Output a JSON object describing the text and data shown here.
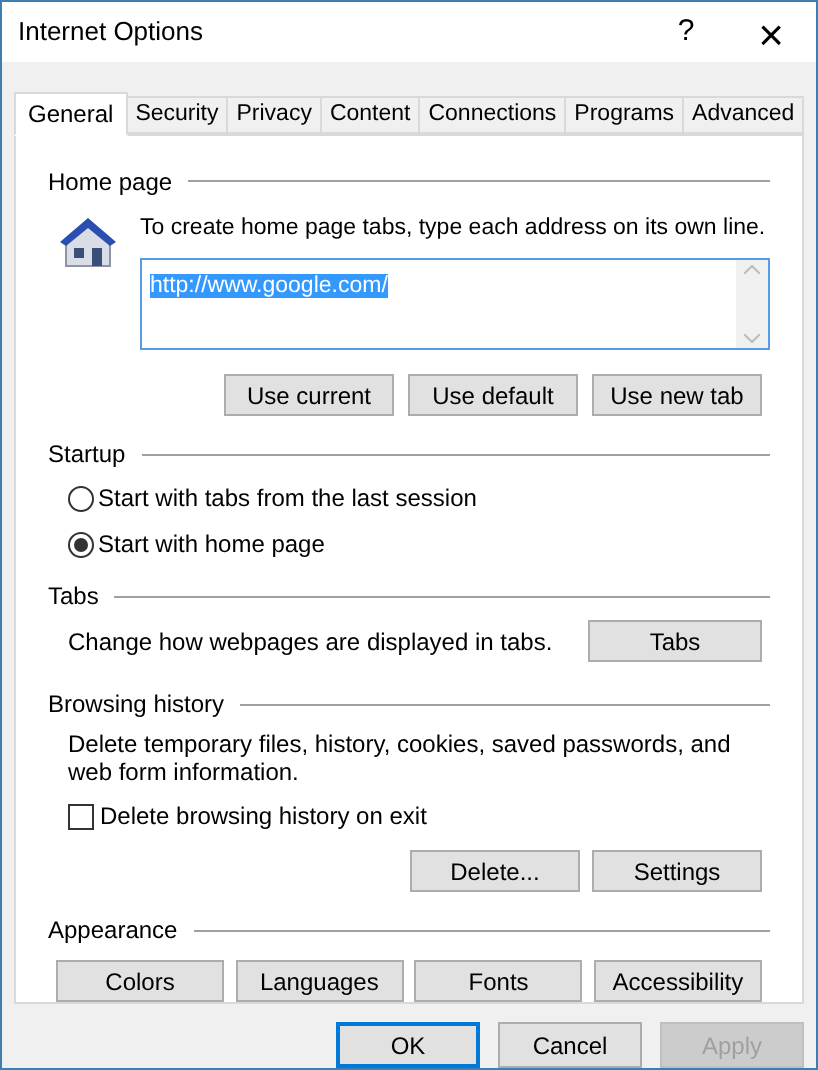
{
  "window": {
    "title": "Internet Options",
    "help": "?",
    "close": "×"
  },
  "tabs": [
    {
      "label": "General",
      "selected": true
    },
    {
      "label": "Security",
      "selected": false
    },
    {
      "label": "Privacy",
      "selected": false
    },
    {
      "label": "Content",
      "selected": false
    },
    {
      "label": "Connections",
      "selected": false
    },
    {
      "label": "Programs",
      "selected": false
    },
    {
      "label": "Advanced",
      "selected": false
    }
  ],
  "home_page": {
    "heading": "Home page",
    "hint": "To create home page tabs, type each address on its own line.",
    "value": "http://www.google.com/",
    "buttons": [
      "Use current",
      "Use default",
      "Use new tab"
    ]
  },
  "startup": {
    "heading": "Startup",
    "options": [
      {
        "label": "Start with tabs from the last session",
        "selected": false
      },
      {
        "label": "Start with home page",
        "selected": true
      }
    ]
  },
  "tabs_section": {
    "heading": "Tabs",
    "text": "Change how webpages are displayed in tabs.",
    "button": "Tabs"
  },
  "browsing_history": {
    "heading": "Browsing history",
    "text": "Delete temporary files, history, cookies, saved passwords, and web form information.",
    "checkbox": {
      "label": "Delete browsing history on exit",
      "checked": false
    },
    "buttons": [
      "Delete...",
      "Settings"
    ]
  },
  "appearance": {
    "heading": "Appearance",
    "buttons": [
      "Colors",
      "Languages",
      "Fonts",
      "Accessibility"
    ]
  },
  "footer": [
    {
      "label": "OK",
      "default": true,
      "disabled": false
    },
    {
      "label": "Cancel",
      "default": false,
      "disabled": false
    },
    {
      "label": "Apply",
      "default": false,
      "disabled": true
    }
  ]
}
